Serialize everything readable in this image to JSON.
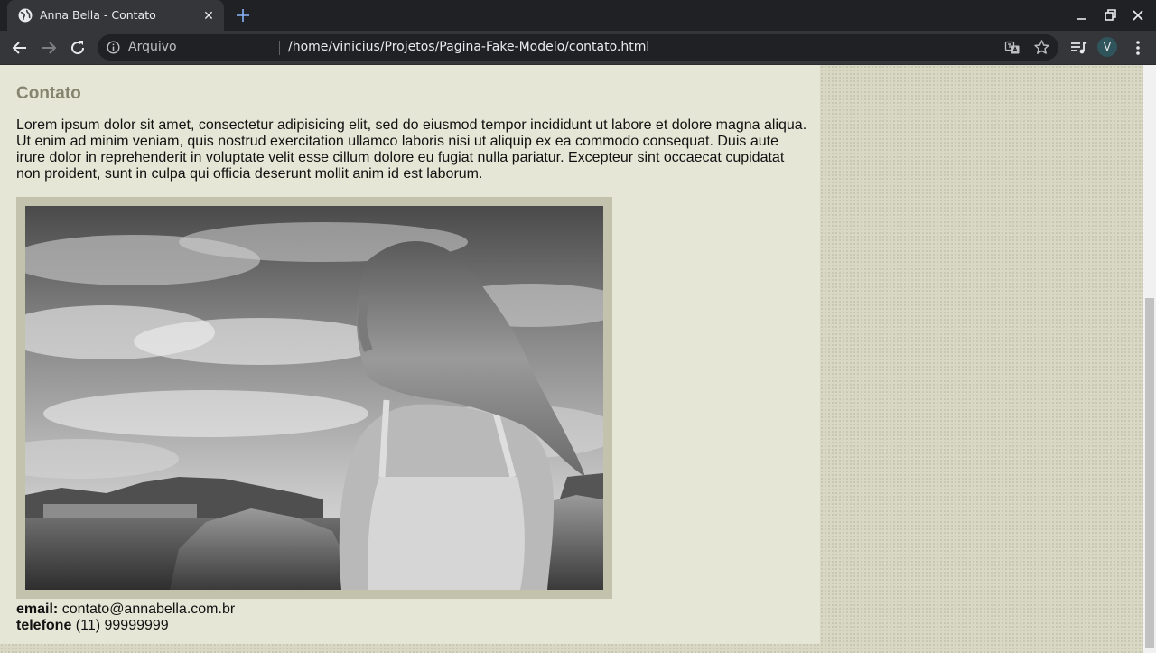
{
  "browser": {
    "tab_title": "Anna Bella - Contato",
    "tab_close": "✕",
    "address_label": "Arquivo",
    "url": "/home/vinicius/Projetos/Pagina-Fake-Modelo/contato.html",
    "profile_initial": "V"
  },
  "page": {
    "heading": "Contato",
    "body_text": "Lorem ipsum dolor sit amet, consectetur adipisicing elit, sed do eiusmod tempor incididunt ut labore et dolore magna aliqua. Ut enim ad minim veniam, quis nostrud exercitation ullamco laboris nisi ut aliquip ex ea commodo consequat. Duis aute irure dolor in reprehenderit in voluptate velit esse cillum dolore eu fugiat nulla pariatur. Excepteur sint occaecat cupidatat non proident, sunt in culpa qui officia deserunt mollit anim id est laborum.",
    "email_label": "email:",
    "email_value": "contato@annabella.com.br",
    "phone_label": "telefone",
    "phone_value": "(11) 99999999"
  },
  "colors": {
    "heading": "#85856f",
    "content_bg": "#e6e6d6",
    "frame": "#c3c3ad"
  }
}
